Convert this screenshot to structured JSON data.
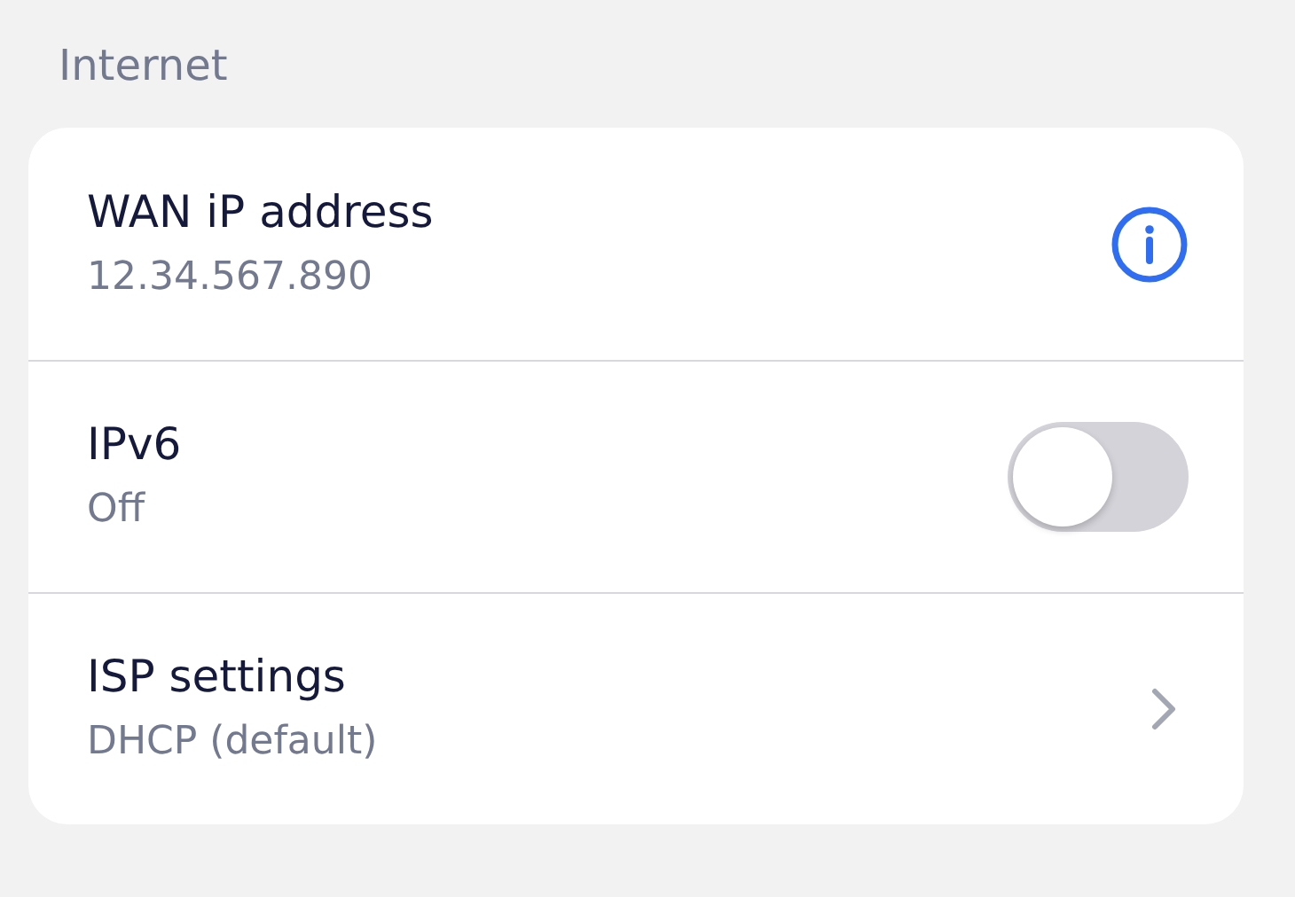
{
  "section": {
    "title": "Internet"
  },
  "rows": [
    {
      "kind": "info",
      "title": "WAN iP address",
      "value": "12.34.567.890"
    },
    {
      "kind": "toggle",
      "title": "IPv6",
      "value": "Off",
      "on": false
    },
    {
      "kind": "link",
      "title": "ISP settings",
      "value": "DHCP (default)"
    }
  ]
}
